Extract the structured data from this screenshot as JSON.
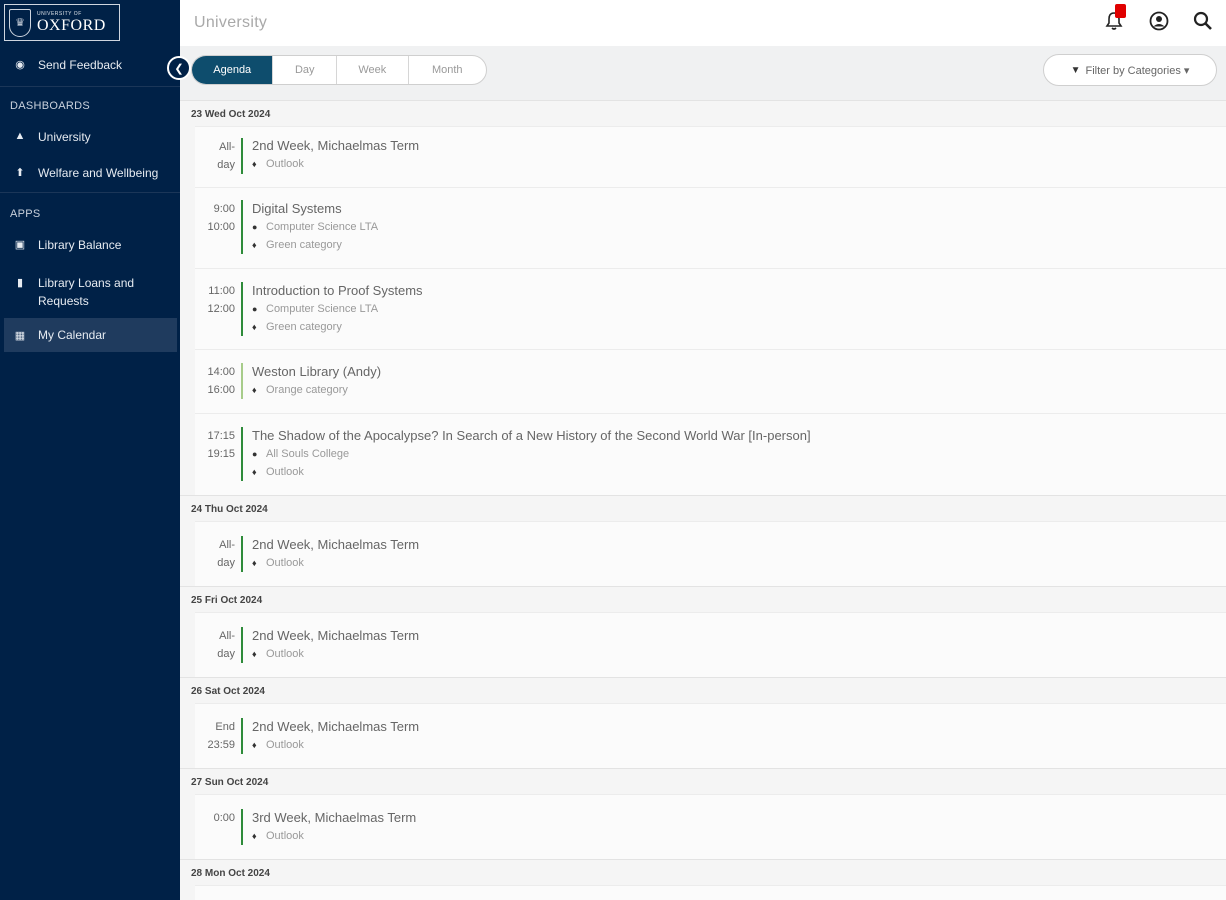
{
  "sidebar": {
    "logo": {
      "small": "UNIVERSITY OF",
      "big": "OXFORD"
    },
    "feedback": "Send Feedback",
    "dashboards_heading": "DASHBOARDS",
    "dashboards": [
      {
        "label": "University",
        "icon": "building-icon"
      },
      {
        "label": "Welfare and Wellbeing",
        "icon": "arrow-up-icon"
      }
    ],
    "apps_heading": "APPS",
    "apps": [
      {
        "label": "Library Balance",
        "icon": "money-icon"
      },
      {
        "label": "Library Loans and Requests",
        "icon": "book-icon"
      },
      {
        "label": "My Calendar",
        "icon": "calendar-icon"
      }
    ]
  },
  "header": {
    "title": "University"
  },
  "toolbar": {
    "views": [
      "Agenda",
      "Day",
      "Week",
      "Month"
    ],
    "active_view": "Agenda",
    "filter_label": "Filter by Categories ▾"
  },
  "colors": {
    "green": "#2e8b3a",
    "light_green": "#a7cc8a",
    "navy": "#002147",
    "teal": "#0e4d6d",
    "badge": "#e00000"
  },
  "days": [
    {
      "date": "23 Wed Oct 2024",
      "events": [
        {
          "time1": "All-",
          "time2": "day",
          "title": "2nd Week, Michaelmas Term",
          "location": "",
          "category": "Outlook"
        },
        {
          "time1": "9:00",
          "time2": "10:00",
          "title": "Digital Systems",
          "location": "Computer Science LTA",
          "category": "Green category"
        },
        {
          "time1": "11:00",
          "time2": "12:00",
          "title": "Introduction to Proof Systems",
          "location": "Computer Science LTA",
          "category": "Green category"
        },
        {
          "time1": "14:00",
          "time2": "16:00",
          "title": "Weston Library (Andy)",
          "location": "",
          "category": "Orange category"
        },
        {
          "time1": "17:15",
          "time2": "19:15",
          "title": "The Shadow of the Apocalypse? In Search of a New History of the Second World War [In-person]",
          "location": "All Souls College",
          "category": "Outlook"
        }
      ]
    },
    {
      "date": "24 Thu Oct 2024",
      "events": [
        {
          "time1": "All-",
          "time2": "day",
          "title": "2nd Week, Michaelmas Term",
          "location": "",
          "category": "Outlook"
        }
      ]
    },
    {
      "date": "25 Fri Oct 2024",
      "events": [
        {
          "time1": "All-",
          "time2": "day",
          "title": "2nd Week, Michaelmas Term",
          "location": "",
          "category": "Outlook"
        }
      ]
    },
    {
      "date": "26 Sat Oct 2024",
      "events": [
        {
          "time1": "End",
          "time2": "23:59",
          "title": "2nd Week, Michaelmas Term",
          "location": "",
          "category": "Outlook"
        }
      ]
    },
    {
      "date": "27 Sun Oct 2024",
      "events": [
        {
          "time1": "0:00",
          "time2": "",
          "title": "3rd Week, Michaelmas Term",
          "location": "",
          "category": "Outlook"
        }
      ]
    },
    {
      "date": "28 Mon Oct 2024",
      "events": []
    }
  ]
}
